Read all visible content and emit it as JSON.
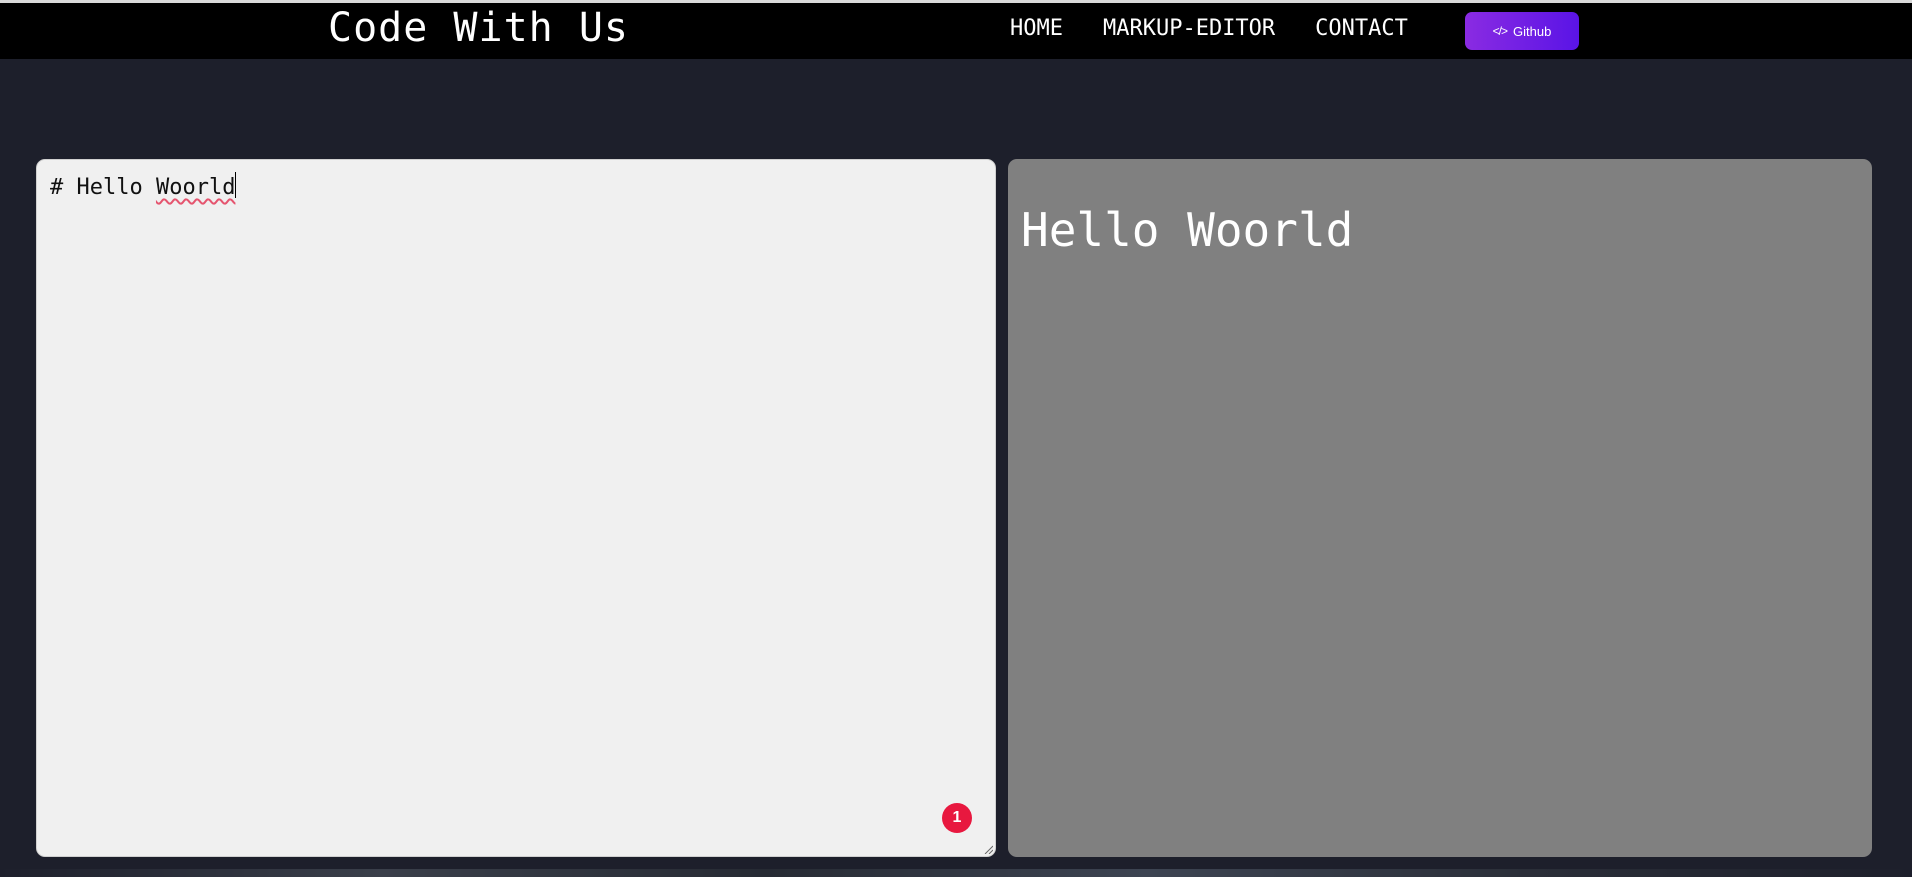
{
  "header": {
    "brand": "Code With Us",
    "nav": [
      {
        "label": "HOME"
      },
      {
        "label": "MARKUP-EDITOR"
      },
      {
        "label": "CONTACT"
      }
    ],
    "github_label": "Github",
    "github_icon": "code-icon"
  },
  "editor": {
    "prefix": "# Hello ",
    "misspelled_word": "Woorld",
    "error_count": "1"
  },
  "preview": {
    "heading": "Hello Woorld"
  },
  "colors": {
    "navbar_bg": "#000000",
    "page_bg": "#1d1f2b",
    "editor_bg": "#f0f0f0",
    "preview_bg": "#808080",
    "badge": "#e8183f",
    "github_gradient_start": "#8a2be2",
    "github_gradient_end": "#5a14e6"
  }
}
